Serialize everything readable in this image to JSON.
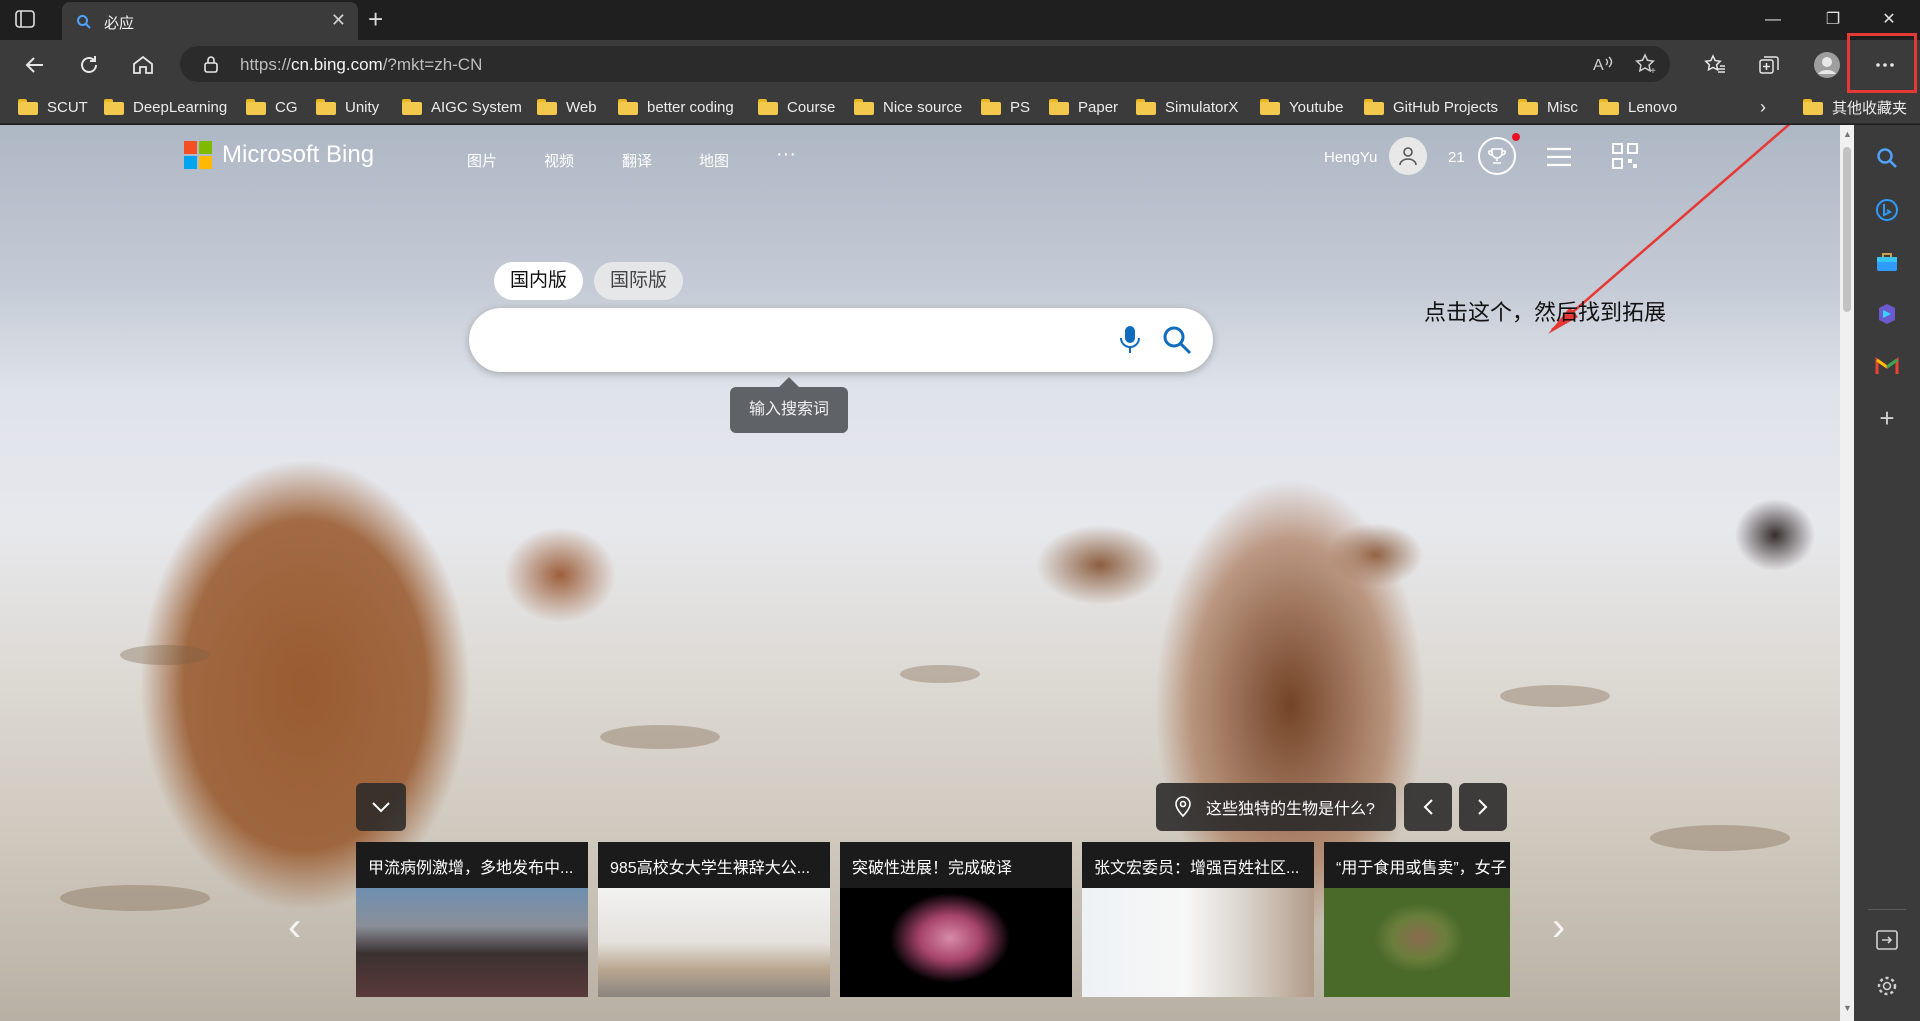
{
  "browser": {
    "tab_title": "必应",
    "url_scheme": "https://",
    "url_host": "cn.bing.com",
    "url_path": "/?mkt=zh-CN"
  },
  "bookmarks": [
    "SCUT",
    "DeepLearning",
    "CG",
    "Unity",
    "AIGC System",
    "Web",
    "better coding",
    "Course",
    "Nice source",
    "PS",
    "Paper",
    "SimulatorX",
    "Youtube",
    "GitHub Projects",
    "Misc",
    "Lenovo"
  ],
  "other_bookmarks": "其他收藏夹",
  "bing": {
    "brand": "Microsoft Bing",
    "nav": [
      "图片",
      "视频",
      "翻译",
      "地图",
      "···"
    ],
    "user_name": "HengYu",
    "points": "21",
    "version_domestic": "国内版",
    "version_international": "国际版",
    "search_tooltip": "输入搜索词",
    "quiz": "这些独特的生物是什么?"
  },
  "annotation": "点击这个，然后找到拓展",
  "news": [
    {
      "headline": "甲流病例激增，多地发布中..."
    },
    {
      "headline": "985高校女大学生裸辞大公..."
    },
    {
      "headline": "突破性进展！完成破译"
    },
    {
      "headline": "张文宏委员：增强百姓社区..."
    },
    {
      "headline": "“用于食用或售卖”，女子"
    }
  ],
  "colors": {
    "annotation_red": "#e53935",
    "ms_red": "#f25022",
    "ms_green": "#7fba00",
    "ms_blue": "#00a4ef",
    "ms_yellow": "#ffb900",
    "search_blue": "#0f6cbd"
  }
}
